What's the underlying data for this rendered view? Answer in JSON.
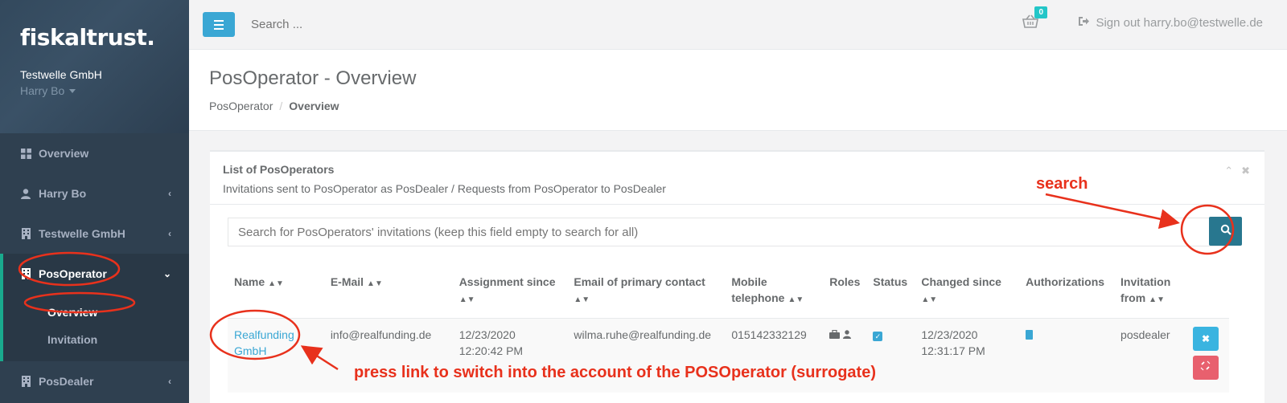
{
  "sidebar": {
    "logo": "fiskaltrust.",
    "company": "Testwelle GmbH",
    "user": "Harry Bo",
    "items": [
      {
        "label": "Overview"
      },
      {
        "label": "Harry Bo"
      },
      {
        "label": "Testwelle GmbH"
      },
      {
        "label": "PosOperator"
      },
      {
        "label": "PosDealer"
      }
    ],
    "sub_items": [
      {
        "label": "Overview"
      },
      {
        "label": "Invitation"
      }
    ]
  },
  "topbar": {
    "search_placeholder": "Search ...",
    "basket_count": "0",
    "signout_label": "Sign out harry.bo@testwelle.de"
  },
  "page": {
    "title": "PosOperator - Overview",
    "breadcrumb": [
      "PosOperator",
      "Overview"
    ]
  },
  "panel": {
    "title": "List of PosOperators",
    "subtitle": "Invitations sent to PosOperator as PosDealer / Requests from PosOperator to PosDealer",
    "search_placeholder": "Search for PosOperators' invitations (keep this field empty to search for all)"
  },
  "table": {
    "headers": [
      "Name",
      "E-Mail",
      "Assignment since",
      "Email of primary contact",
      "Mobile telephone",
      "Roles",
      "Status",
      "Changed since",
      "Authorizations",
      "Invitation from"
    ],
    "rows": [
      {
        "name": "Realfunding GmbH",
        "email": "info@realfunding.de",
        "assignment_date": "12/23/2020",
        "assignment_time": "12:20:42 PM",
        "contact_email": "wilma.ruhe@realfunding.de",
        "mobile": "015142332129",
        "changed_date": "12/23/2020",
        "changed_time": "12:31:17 PM",
        "invitation_from": "posdealer"
      }
    ]
  },
  "annotations": {
    "search": "search",
    "link_hint": "press link to switch into the account of the POSOperator (surrogate)",
    "color": "#e8311c"
  },
  "colors": {
    "sidebar": "#2f4050",
    "accent": "#19aa8d",
    "primary": "#3aa7d4",
    "search_button": "#28778f"
  }
}
